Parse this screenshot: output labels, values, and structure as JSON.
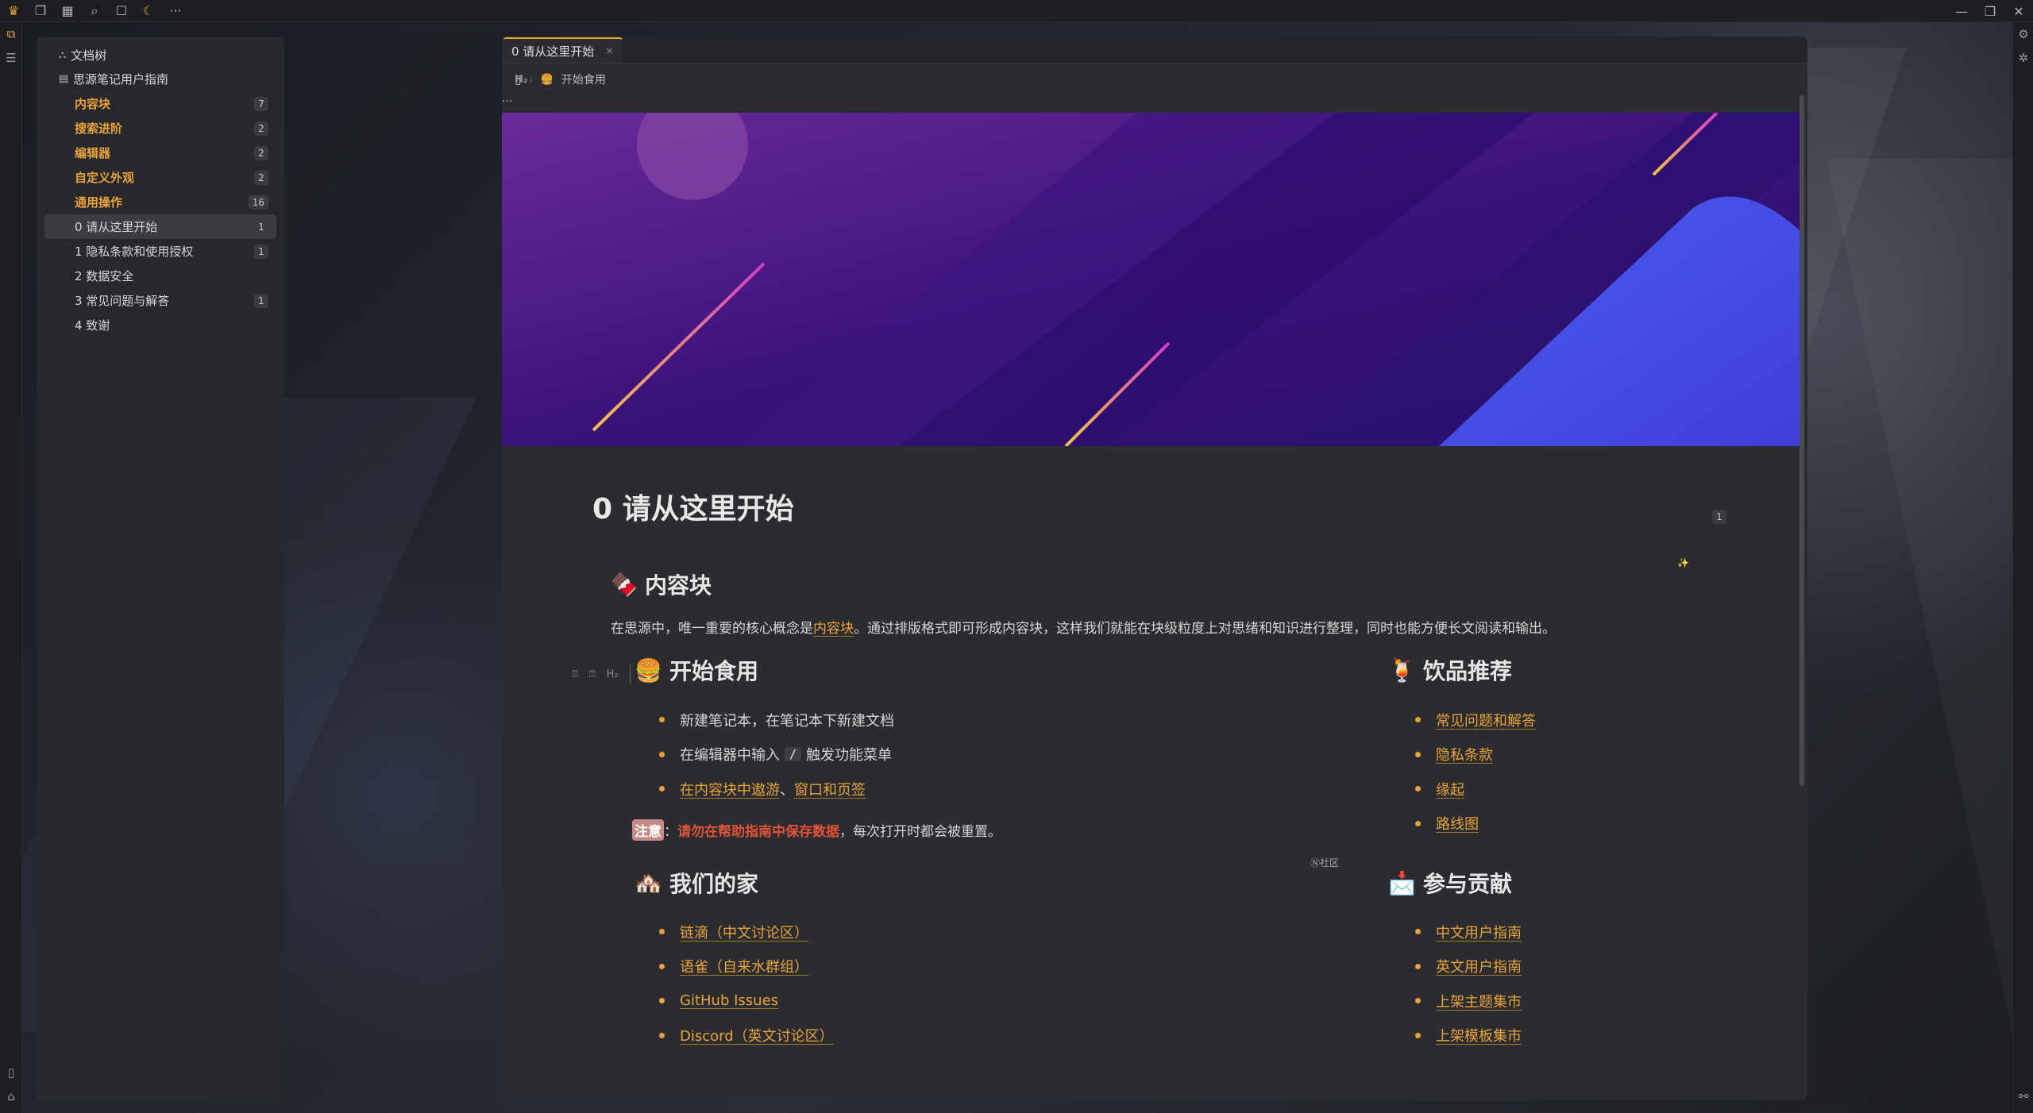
{
  "app": {
    "brand_color": "#e8a33a",
    "titlebar_icons": [
      "crown-icon",
      "file-icon",
      "calendar-icon",
      "search-icon",
      "square-icon",
      "moon-icon",
      "more-icon"
    ],
    "window_controls": [
      "minimize-icon",
      "maximize-icon",
      "close-icon"
    ]
  },
  "tree": {
    "header": "文档树",
    "notebook": "思源笔记用户指南",
    "items": [
      {
        "label": "内容块",
        "count": "7",
        "folder": true
      },
      {
        "label": "搜索进阶",
        "count": "2",
        "folder": true
      },
      {
        "label": "编辑器",
        "count": "2",
        "folder": true
      },
      {
        "label": "自定义外观",
        "count": "2",
        "folder": true
      },
      {
        "label": "通用操作",
        "count": "16",
        "folder": true
      },
      {
        "label": "0 请从这里开始",
        "count": "1",
        "folder": false,
        "active": true
      },
      {
        "label": "1 隐私条款和使用授权",
        "count": "1",
        "folder": false
      },
      {
        "label": "2 数据安全",
        "count": "",
        "folder": false
      },
      {
        "label": "3 常见问题与解答",
        "count": "1",
        "folder": false
      },
      {
        "label": "4 致谢",
        "count": "",
        "folder": false
      }
    ]
  },
  "editor": {
    "tab_label": "0 请从这里开始",
    "tab_close": "×",
    "breadcrumb": {
      "h2_marker": "H₂",
      "heading": "开始食用",
      "more": "···"
    },
    "doc_title": "0 请从这里开始",
    "doc_badge": "1",
    "sections": {
      "blocks": {
        "emoji": "🍫",
        "title": "内容块",
        "para_before": "在思源中，唯一重要的核心概念是",
        "para_link": "内容块",
        "para_after": "。通过排版格式即可形成内容块，这样我们就能在块级粒度上对思绪和知识进行整理，同时也能方便长文阅读和输出。"
      },
      "start": {
        "emoji": "🍔",
        "title": "开始食用",
        "gutter_h2": "H₂",
        "items": {
          "i1": "新建笔记本，在笔记本下新建文档",
          "i2_before": "在编辑器中输入",
          "i2_kbd": "/",
          "i2_after": "触发功能菜单",
          "i3_link1": "在内容块中遨游",
          "i3_sep": "、",
          "i3_link2": "窗口和页签"
        },
        "note_tag": "注意",
        "note_colon": "：",
        "note_red": "请勿在帮助指南中保存数据",
        "note_after": "，每次打开时都会被重置。"
      },
      "drinks": {
        "emoji": "🍹",
        "title": "饮品推荐",
        "links": [
          "常见问题和解答",
          "隐私条款",
          "缘起",
          "路线图"
        ]
      },
      "home": {
        "emoji": "🏘️",
        "title": "我们的家",
        "links": [
          "链滴（中文讨论区）",
          "语雀（自来水群组）",
          "GitHub Issues",
          "Discord（英文讨论区）"
        ]
      },
      "contribute": {
        "emoji": "📩",
        "title": "参与贡献",
        "links": [
          "中文用户指南",
          "英文用户指南",
          "上架主题集市",
          "上架模板集市"
        ]
      },
      "community_label": "Ⓝ社区"
    }
  }
}
